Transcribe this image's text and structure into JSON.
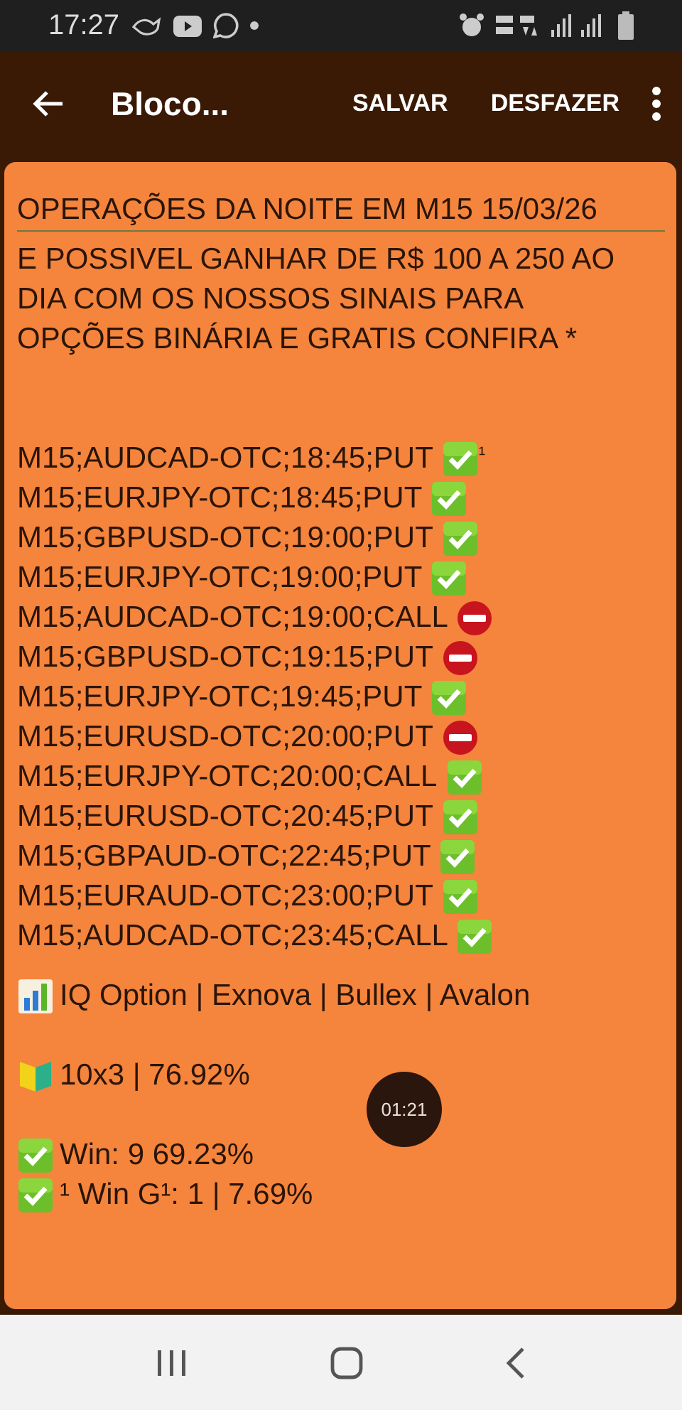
{
  "status_bar": {
    "time": "17:27"
  },
  "app_bar": {
    "title": "Bloco...",
    "actions": [
      "SALVAR",
      "DESFAZER"
    ]
  },
  "note": {
    "title": "OPERAÇÕES DA NOITE EM M15 15/03/26",
    "intro": "E POSSIVEL GANHAR DE R$ 100 A 250 AO DIA COM OS NOSSOS SINAIS PARA OPÇÕES BINÁRIA E GRATIS CONFIRA *",
    "signals": [
      {
        "text": "M15;AUDCAD-OTC;18:45;PUT",
        "kind": "win",
        "suffix": "¹"
      },
      {
        "text": "M15;EURJPY-OTC;18:45;PUT",
        "kind": "win"
      },
      {
        "text": "M15;GBPUSD-OTC;19:00;PUT",
        "kind": "win"
      },
      {
        "text": "M15;EURJPY-OTC;19:00;PUT",
        "kind": "win"
      },
      {
        "text": "M15;AUDCAD-OTC;19:00;CALL",
        "kind": "loss"
      },
      {
        "text": "M15;GBPUSD-OTC;19:15;PUT",
        "kind": "loss"
      },
      {
        "text": "M15;EURJPY-OTC;19:45;PUT",
        "kind": "win"
      },
      {
        "text": "M15;EURUSD-OTC;20:00;PUT",
        "kind": "loss"
      },
      {
        "text": "M15;EURJPY-OTC;20:00;CALL",
        "kind": "win"
      },
      {
        "text": "M15;EURUSD-OTC;20:45;PUT",
        "kind": "win"
      },
      {
        "text": "M15;GBPAUD-OTC;22:45;PUT",
        "kind": "win"
      },
      {
        "text": "M15;EURAUD-OTC;23:00;PUT",
        "kind": "win"
      },
      {
        "text": "M15;AUDCAD-OTC;23:45;CALL",
        "kind": "win"
      }
    ],
    "summary": [
      {
        "lines": [
          {
            "kind": "chart",
            "text": "IQ Option | Exnova | Bullex | Avalon"
          }
        ]
      },
      {
        "lines": [
          {
            "kind": "beginner",
            "text": "10x3 | 76.92%"
          }
        ]
      },
      {
        "lines": [
          {
            "kind": "check",
            "text": "Win: 9 69.23%"
          },
          {
            "kind": "check",
            "text": "¹ Win G¹: 1 | 7.69%"
          }
        ]
      }
    ]
  },
  "timer": "01:21"
}
